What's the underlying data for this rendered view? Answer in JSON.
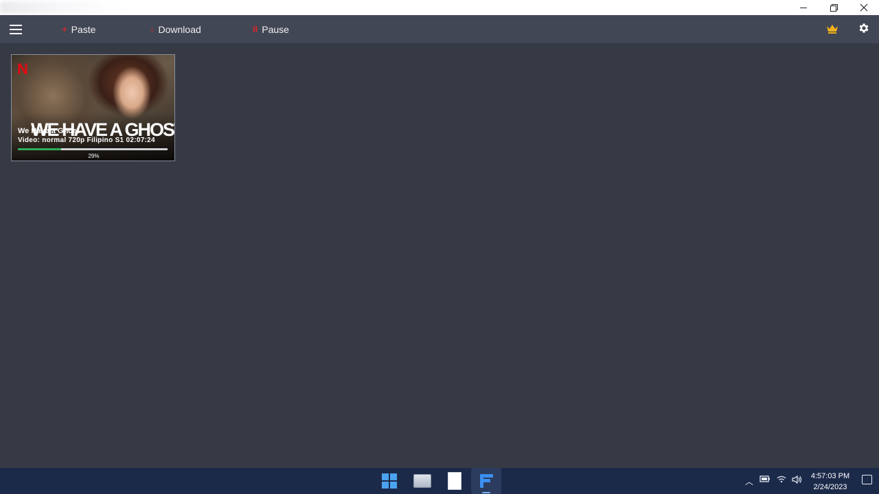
{
  "window": {
    "controls": {
      "minimize": "─",
      "maximize": "restore",
      "close": "✕"
    }
  },
  "toolbar": {
    "paste_label": "Paste",
    "download_label": "Download",
    "pause_label": "Pause",
    "paste_icon": "+",
    "download_icon": "↓",
    "pause_icon": "II",
    "accent_color": "#d6252d"
  },
  "downloads": [
    {
      "poster_brand": "N",
      "poster_title": "WE HAVE A GHOST",
      "title": "We Have a Ghost",
      "info": "Video:  normal  720p  Filipino  S1  02:07:24",
      "progress": 0.29,
      "progress_text": "29%",
      "progress_color": "#2fae5a"
    }
  ],
  "taskbar": {
    "time": "4:57:03 PM",
    "date": "2/24/2023",
    "apps": [
      "windows-start-icon",
      "file-explorer-icon",
      "document-icon",
      "downloader-app-icon"
    ]
  }
}
